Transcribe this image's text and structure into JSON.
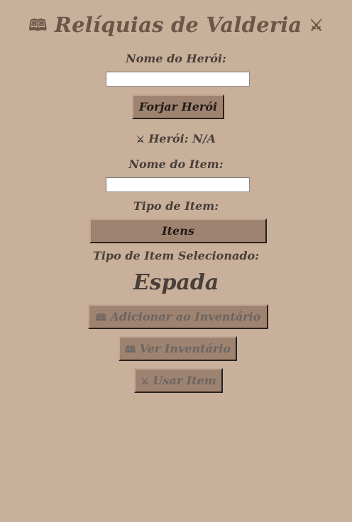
{
  "app": {
    "title": "Relíquias de Valderia",
    "title_icon_left": "🕮",
    "title_icon_right": "⚔"
  },
  "hero": {
    "name_label": "Nome do Herói:",
    "name_value": "",
    "forge_button": "Forjar Herói",
    "status_icon": "⚔",
    "status_text": "Herói: N/A"
  },
  "item": {
    "name_label": "Nome do Item:",
    "name_value": "",
    "type_label": "Tipo de Item:",
    "type_select": "Itens",
    "selected_label": "Tipo de Item Selecionado:",
    "selected_value": "Espada"
  },
  "actions": {
    "add_icon": "🕮",
    "add_label": "Adicionar ao Inventário",
    "view_icon": "🕮",
    "view_label": "Ver Inventário",
    "use_icon": "⚔",
    "use_label": "Usar Item"
  },
  "colors": {
    "background": "#c8b09b",
    "title": "#6e5548",
    "button": "#9e8371",
    "text": "#4a3f38",
    "disabled_text": "#6c6460"
  }
}
